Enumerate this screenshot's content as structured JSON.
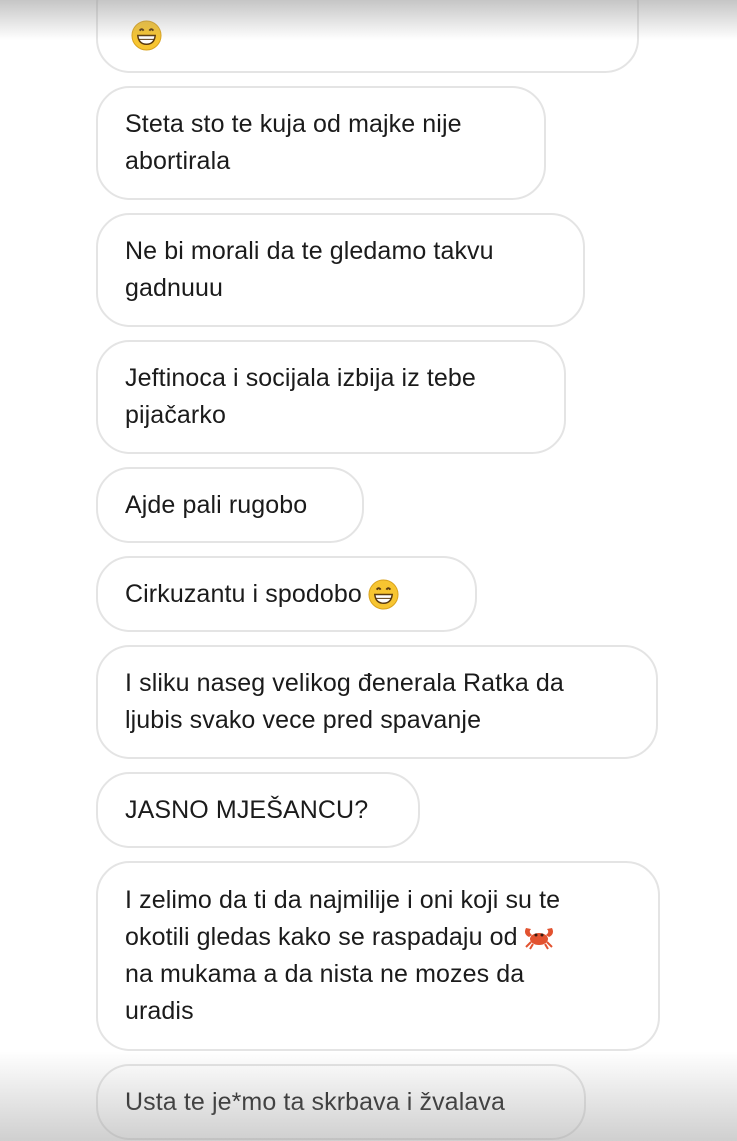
{
  "messages": [
    {
      "text": "",
      "emoji": "grinning-face-icon"
    },
    {
      "text": "Steta sto te kuja od majke nije\nabortirala"
    },
    {
      "text": "Ne bi morali da te gledamo takvu\ngadnuuu"
    },
    {
      "text": "Jeftinoca i socijala izbija iz tebe\npijačarko"
    },
    {
      "text": "Ajde pali rugobo"
    },
    {
      "text": "Cirkuzantu i spodobo",
      "emoji": "grinning-face-icon"
    },
    {
      "text": "I sliku naseg velikog đenerala Ratka da\nljubis svako vece pred spavanje"
    },
    {
      "text": "JASNO MJEŠANCU?"
    },
    {
      "text_a": "I zelimo da ti da najmilije i oni koji su te\nokotili gledas kako se raspadaju od",
      "emoji": "crab-icon",
      "text_b": "na mukama a da nista ne mozes da\nuradis"
    },
    {
      "text": "Usta te je*mo ta skrbava i žvalava"
    }
  ],
  "colors": {
    "bubble_border": "#e4e4e4",
    "text": "#1b1b1b",
    "background": "#ffffff",
    "emoji_face": "#f7c531",
    "crab": "#e2522f"
  }
}
